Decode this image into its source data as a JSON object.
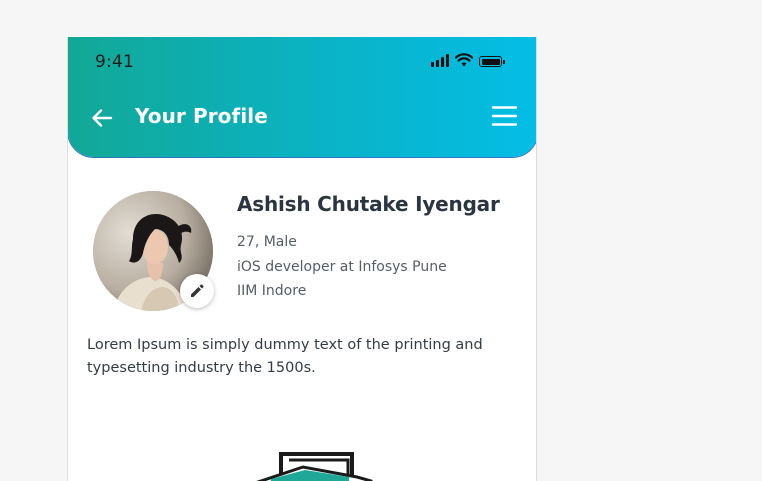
{
  "status_bar": {
    "time": "9:41",
    "icons": [
      "signal-icon",
      "wifi-icon",
      "battery-icon"
    ]
  },
  "app_bar": {
    "title": "Your Profile",
    "back_icon": "arrow-left-icon",
    "menu_icon": "hamburger-menu-icon"
  },
  "profile": {
    "name": "Ashish Chutake Iyengar",
    "age_gender": "27, Male",
    "occupation": "iOS developer at Infosys Pune",
    "education": "IIM Indore",
    "bio": "Lorem Ipsum is simply dummy text of the printing and typesetting industry the 1500s.",
    "edit_icon": "pencil-icon"
  },
  "colors": {
    "gradient_start": "#12a896",
    "gradient_end": "#04bde6",
    "name_text": "#2b3541",
    "body_text": "#555d66",
    "accent_teal": "#1fa898"
  }
}
